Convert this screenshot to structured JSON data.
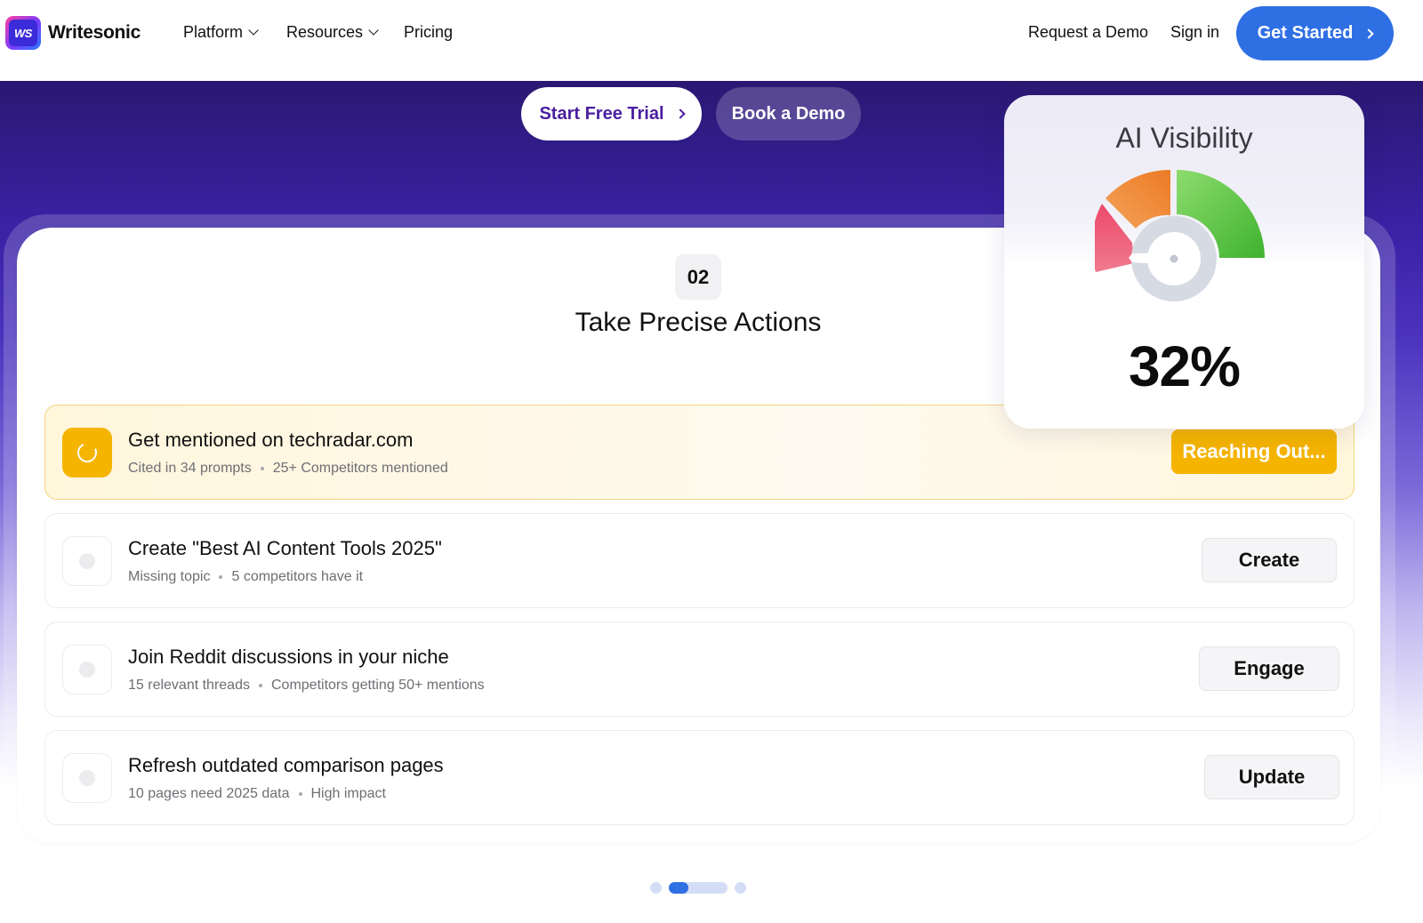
{
  "nav": {
    "brand": "Writesonic",
    "brand_mark": "WS",
    "links": [
      "Platform",
      "Resources",
      "Pricing"
    ],
    "request_demo": "Request a Demo",
    "sign_in": "Sign in",
    "get_started": "Get Started"
  },
  "hero": {
    "start_trial": "Start Free Trial",
    "book_demo": "Book a Demo"
  },
  "card": {
    "step": "02",
    "title": "Take Precise Actions",
    "rows": [
      {
        "title": "Get mentioned on techradar.com",
        "meta1": "Cited in 34 prompts",
        "meta2": "25+ Competitors mentioned",
        "action": "Reaching Out...",
        "state": "active"
      },
      {
        "title": "Create \"Best AI Content Tools 2025\"",
        "meta1": "Missing topic",
        "meta2": "5 competitors have it",
        "action": "Create",
        "state": "idle"
      },
      {
        "title": "Join Reddit discussions in your niche",
        "meta1": "15 relevant threads",
        "meta2": "Competitors getting 50+ mentions",
        "action": "Engage",
        "state": "idle"
      },
      {
        "title": "Refresh outdated comparison pages",
        "meta1": "10 pages need 2025 data",
        "meta2": "High impact",
        "action": "Update",
        "state": "idle"
      }
    ]
  },
  "visibility": {
    "title": "AI Visibility",
    "value": "32%",
    "level": 0.32
  },
  "pager": {
    "pages": 3,
    "current": 1
  },
  "colors": {
    "accent": "#2f6fe4",
    "active": "#f5b400",
    "hero_top": "#2a1872"
  }
}
